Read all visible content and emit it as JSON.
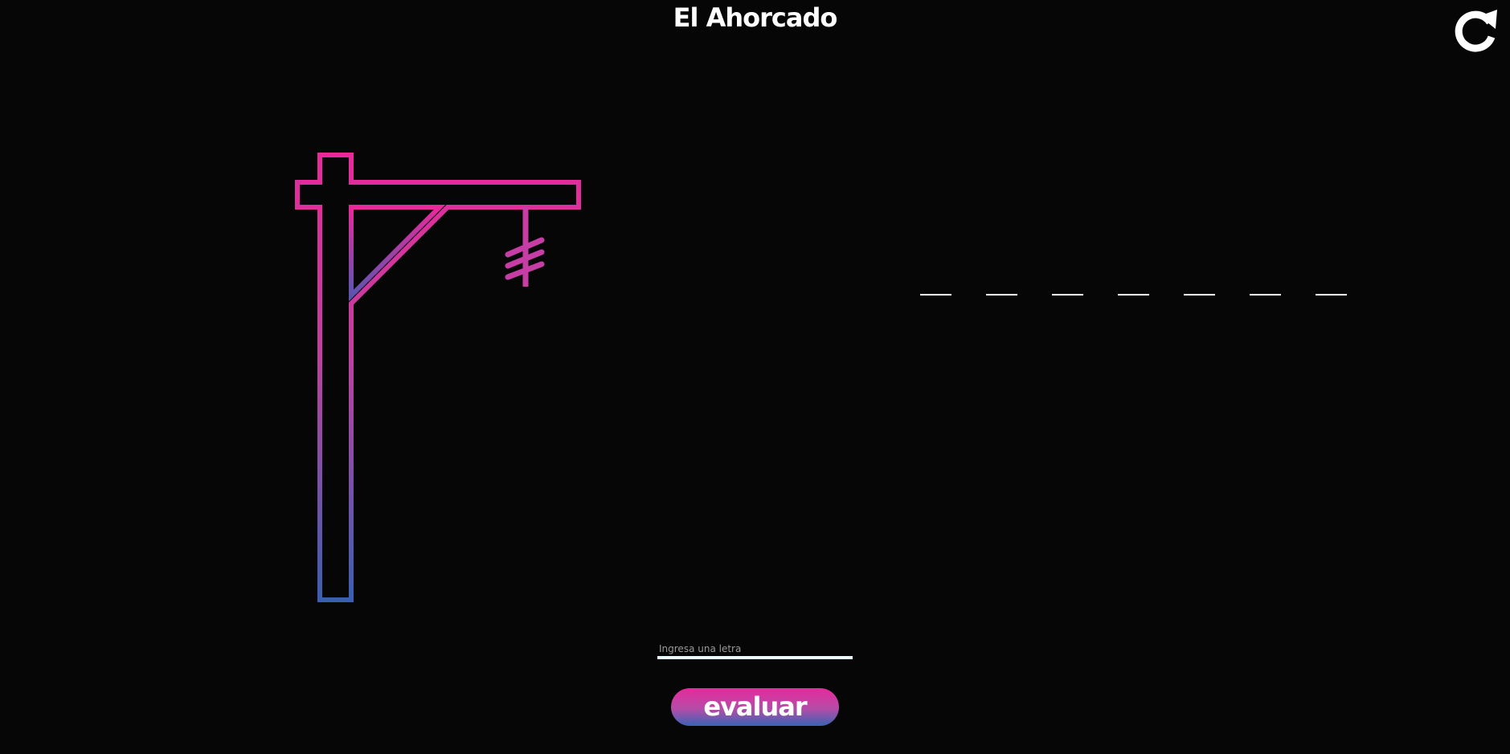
{
  "header": {
    "title": "El Ahorcado",
    "restart_icon": "restart-icon"
  },
  "gallows": {
    "icon": "gallows-icon",
    "color_top": "#e8299b",
    "color_bottom": "#3a5fb0"
  },
  "word": {
    "slots": [
      "",
      "",
      "",
      "",
      "",
      "",
      ""
    ]
  },
  "input": {
    "placeholder": "Ingresa una letra",
    "value": ""
  },
  "actions": {
    "evaluate_label": "evaluar"
  },
  "colors": {
    "background": "#060606",
    "accent_pink": "#e8299b",
    "accent_blue": "#3963b4"
  }
}
